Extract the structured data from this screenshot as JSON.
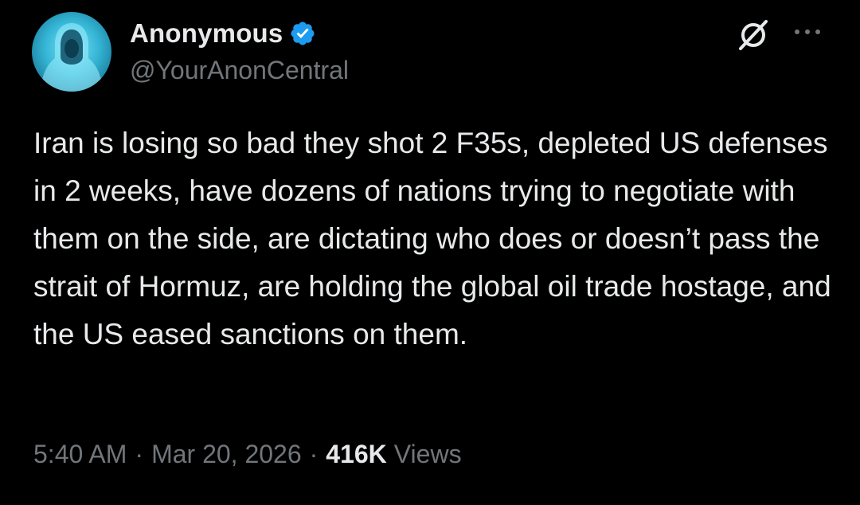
{
  "author": {
    "display_name": "Anonymous",
    "handle": "@YourAnonCentral",
    "verified": true,
    "avatar_icon": "hooded-figure-avatar"
  },
  "header_actions": {
    "grok_icon": "grok-icon",
    "more_icon": "more-horizontal-icon"
  },
  "tweet": {
    "text": "Iran is losing so bad they shot 2 F35s, depleted US defenses in 2 weeks, have dozens of nations trying to negotiate with them on the side, are dictating who does or doesn’t pass the strait of Hormuz, are holding the global oil trade hostage, and the US eased sanctions on them."
  },
  "meta": {
    "time": "5:40 AM",
    "separator": "·",
    "date": "Mar 20, 2026",
    "views_count": "416K",
    "views_label": "Views"
  },
  "colors": {
    "background": "#000000",
    "primary_text": "#e7e9ea",
    "secondary_text": "#71767b",
    "verified_badge": "#1d9bf0"
  }
}
